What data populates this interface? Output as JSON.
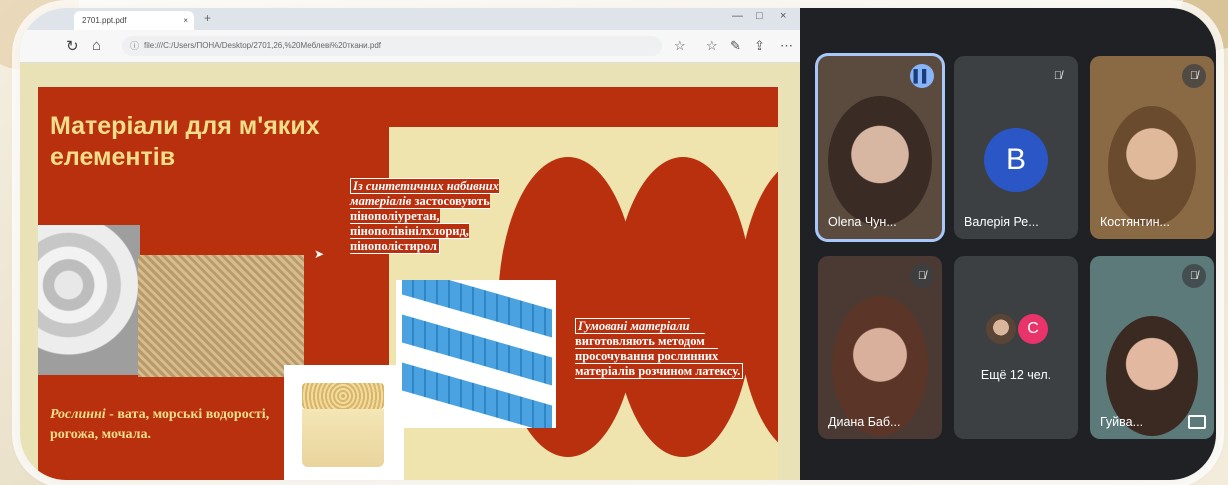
{
  "browser": {
    "tab_title": "2701.ppt.pdf",
    "tab_close": "×",
    "new_tab": "+",
    "window_controls": [
      "—",
      "□",
      "×"
    ],
    "url": "file:///C:/Users/ПОНА/Desktop/2701,26,%20Меблеві%20ткани.pdf",
    "url_info_icon": "info-icon",
    "nav_icons": [
      "reload-icon",
      "home-icon"
    ],
    "toolbar_icons": [
      "favorite-star-icon",
      "favorites-icon",
      "pen-icon",
      "share-icon",
      "more-icon"
    ]
  },
  "slide": {
    "title": "Матеріали для м'яких елементів",
    "synthetic_text": {
      "italic": "Із синтетичних набивних матеріалів",
      "rest": "застосовують пінополіуретан, пінополівінілхлорид, пінополістирол"
    },
    "rubber_text": {
      "italic": "Гумовані матеріали",
      "rest": "виготовляють методом просочування рослинних матеріалів розчином латексу."
    },
    "plant_text": {
      "italic": "Рослинні",
      "rest": " - вата, морські водорості, рогожа, мочала."
    },
    "colors": {
      "slide_red": "#b9300f",
      "cream": "#efe4ad",
      "title_yellow": "#f2de8a"
    }
  },
  "meeting": {
    "participants": [
      {
        "name": "Olena Чун...",
        "state": "speaking"
      },
      {
        "name": "Валерія Ре...",
        "initial": "В",
        "state": "muted"
      },
      {
        "name": "Костянтин...",
        "state": "muted"
      },
      {
        "name": "Диана Баб...",
        "state": "muted"
      },
      {
        "name": "Ещё 12 чел.",
        "initial": "C",
        "state": "group"
      },
      {
        "name": "Гуйва...",
        "state": "muted"
      }
    ],
    "mute_glyph": "🎙̸",
    "speaking_glyph": "▌▌",
    "colors": {
      "background": "#202124",
      "tile": "#3c4043",
      "avatar_blue": "#2a56c6",
      "avatar_pink": "#e8336b"
    }
  }
}
